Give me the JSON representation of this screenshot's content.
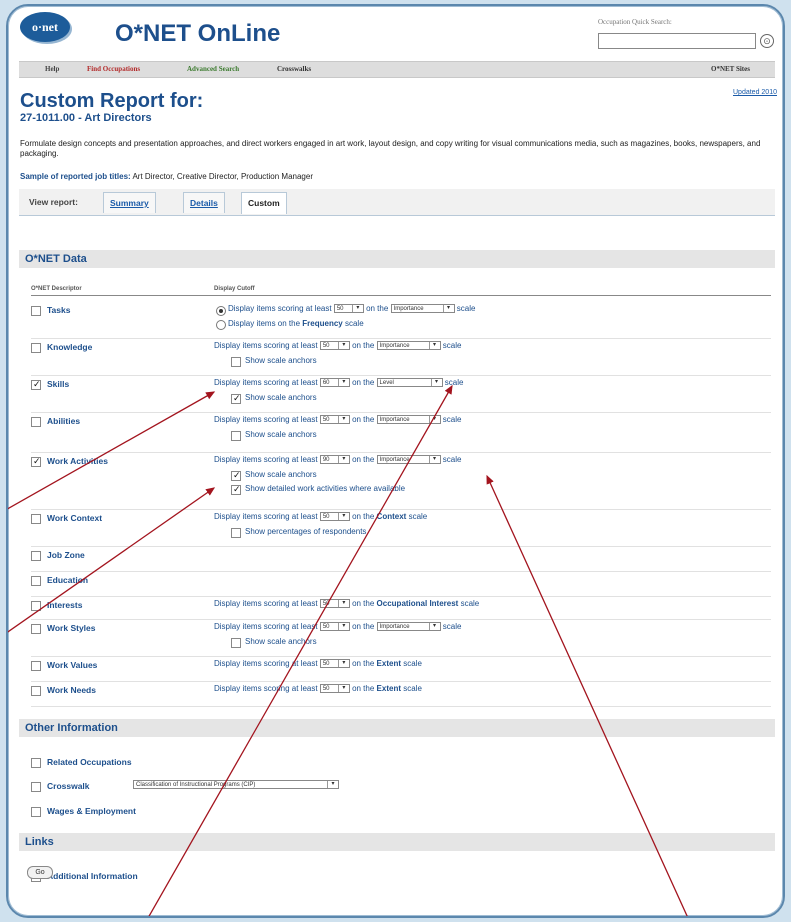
{
  "header": {
    "logo_text": "o·net",
    "brand": "O*NET OnLine",
    "quick_search_label": "Occupation Quick Search:",
    "quick_search_value": "",
    "go_glyph": "⊙"
  },
  "nav": {
    "items": [
      "Help",
      "Find Occupations",
      "Advanced Search",
      "Crosswalks"
    ],
    "right": "O*NET Sites"
  },
  "updated": "Updated 2010",
  "report": {
    "title": "Custom Report for:",
    "subtitle": "27-1011.00 - Art Directors",
    "description": "Formulate design concepts and presentation approaches, and direct workers engaged in art work, layout design, and copy writing for visual communications media, such as magazines, books, newspapers, and packaging.",
    "sample_label": "Sample of reported job titles:",
    "sample_titles": "Art Director, Creative Director, Production Manager"
  },
  "tabs": {
    "label": "View report:",
    "items": [
      "Summary",
      "Details",
      "Custom"
    ],
    "active": "Custom"
  },
  "sections": {
    "onet": "O*NET Data",
    "other": "Other Information",
    "links": "Links"
  },
  "columns": {
    "descriptor": "O*NET Descriptor",
    "cutoff": "Display Cutoff"
  },
  "text": {
    "display_at_least": "Display items scoring at least",
    "on_the": "on the",
    "scale": "scale",
    "show_scale_anchors": "Show scale anchors",
    "display_frequency_pre": "Display items on the",
    "frequency": "Frequency",
    "show_detailed_wa": "Show detailed work activities where available",
    "show_percentages": "Show percentages of respondents"
  },
  "rows": [
    {
      "label": "Tasks",
      "checked": false,
      "score": "50",
      "scale": "Importance"
    },
    {
      "label": "Knowledge",
      "checked": false,
      "score": "50",
      "scale": "Importance"
    },
    {
      "label": "Skills",
      "checked": true,
      "score": "60",
      "scale": "Level",
      "anchors": true
    },
    {
      "label": "Abilities",
      "checked": false,
      "score": "50",
      "scale": "Importance"
    },
    {
      "label": "Work Activities",
      "checked": true,
      "score": "90",
      "scale": "Importance",
      "anchors": true,
      "detailed": true
    },
    {
      "label": "Work Context",
      "checked": false,
      "score": "50",
      "scale": "Context"
    },
    {
      "label": "Job Zone",
      "checked": false
    },
    {
      "label": "Education",
      "checked": false
    },
    {
      "label": "Interests",
      "checked": false,
      "score": "50",
      "scale": "Occupational Interest"
    },
    {
      "label": "Work Styles",
      "checked": false,
      "score": "50",
      "scale": "Importance"
    },
    {
      "label": "Work Values",
      "checked": false,
      "score": "50",
      "scale": "Extent"
    },
    {
      "label": "Work Needs",
      "checked": false,
      "score": "50",
      "scale": "Extent"
    }
  ],
  "other_rows": [
    {
      "label": "Related Occupations",
      "checked": false
    },
    {
      "label": "Crosswalk",
      "checked": false,
      "select": "Classification of Instructional Programs (CIP)"
    },
    {
      "label": "Wages & Employment",
      "checked": false
    }
  ],
  "link_rows": [
    {
      "label": "Additional Information",
      "checked": false
    }
  ],
  "go_button": "Go",
  "check_glyph": "✓",
  "arrow_glyph": "▾",
  "annotation_color": "#a3141e"
}
